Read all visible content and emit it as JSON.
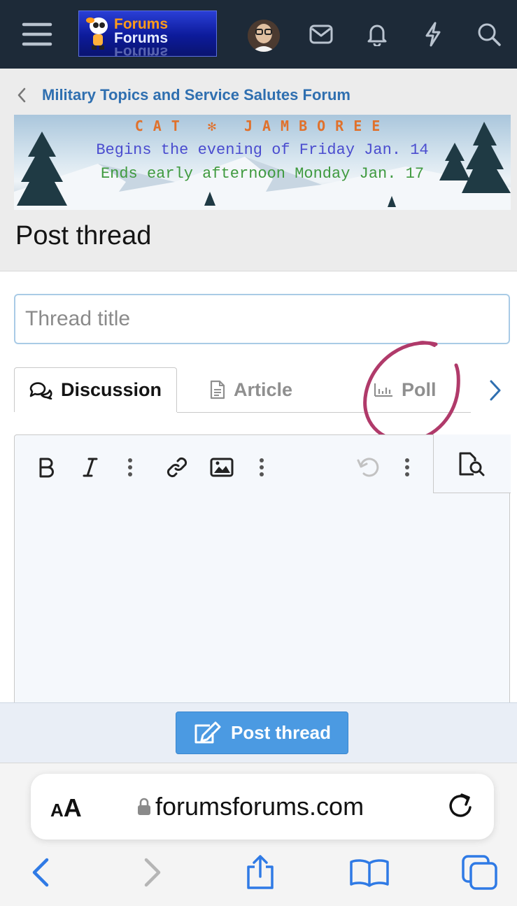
{
  "header": {
    "logo_line1": "Forums",
    "logo_line2": "Forums",
    "icons": [
      "menu-icon",
      "avatar",
      "envelope-icon",
      "bell-icon",
      "lightning-icon",
      "search-icon"
    ]
  },
  "breadcrumb": {
    "label": "Military Topics and Service Salutes Forum"
  },
  "banner": {
    "title": "CAT ✻ JAMBOREE",
    "line1": "Begins the evening of Friday Jan. 14",
    "line2": "Ends early afternoon Monday Jan. 17"
  },
  "page": {
    "title": "Post thread"
  },
  "form": {
    "thread_title_placeholder": "Thread title",
    "tabs": [
      {
        "label": "Discussion",
        "icon": "discussion-icon",
        "active": true
      },
      {
        "label": "Article",
        "icon": "article-icon",
        "active": false
      },
      {
        "label": "Poll",
        "icon": "poll-icon",
        "active": false
      }
    ],
    "toolbar": [
      "bold",
      "italic",
      "more",
      "link",
      "image",
      "more",
      "undo",
      "more",
      "preview"
    ]
  },
  "submit": {
    "label": "Post thread"
  },
  "browser": {
    "text_size_label_small": "A",
    "text_size_label_large": "A",
    "url": "forumsforums.com"
  },
  "colors": {
    "navbar": "#1d2a38",
    "link": "#2f6fb0",
    "accent": "#4b9ae2",
    "annotation": "#b03a6a",
    "ios_blue": "#2f7ae5"
  }
}
